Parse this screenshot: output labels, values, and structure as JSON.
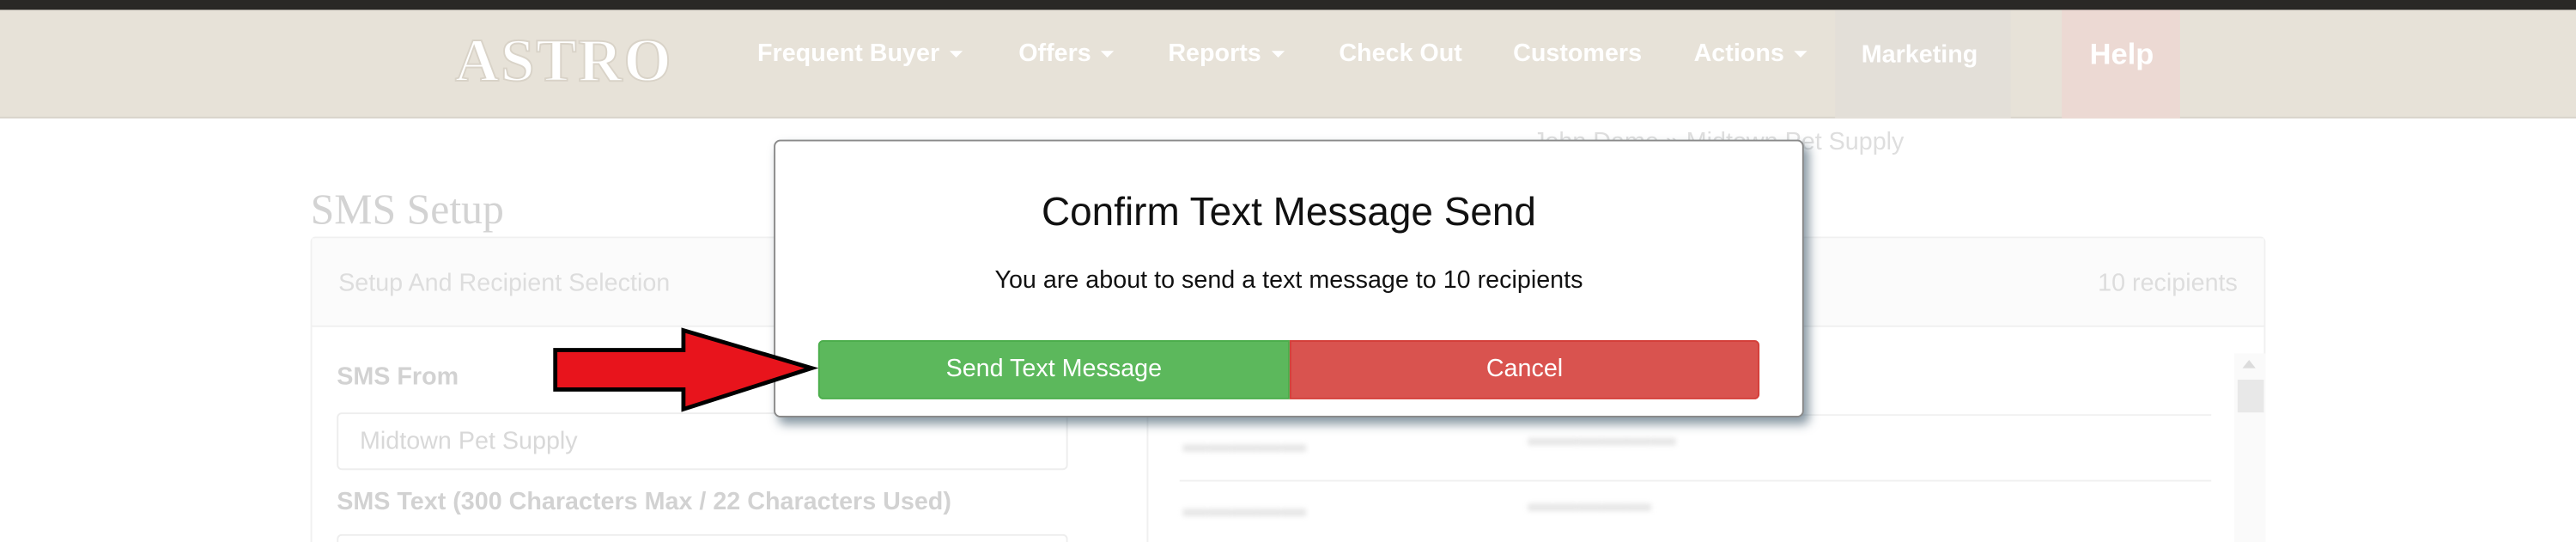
{
  "header": {
    "logo": "ASTRO",
    "nav": [
      {
        "label": "Frequent Buyer",
        "dropdown": true
      },
      {
        "label": "Offers",
        "dropdown": true
      },
      {
        "label": "Reports",
        "dropdown": true
      },
      {
        "label": "Check Out",
        "dropdown": false
      },
      {
        "label": "Customers",
        "dropdown": false
      },
      {
        "label": "Actions",
        "dropdown": true
      },
      {
        "label": "Marketing",
        "dropdown": false
      }
    ],
    "help_label": "Help"
  },
  "breadcrumb": "John Dame » Midtown Pet Supply",
  "page": {
    "title": "SMS Setup",
    "panel_title": "Setup And Recipient Selection",
    "recipients_count": "10 recipients",
    "sms_from_label": "SMS From",
    "sms_from_value": "Midtown Pet Supply",
    "sms_text_label": "SMS Text (300 Characters Max / 22 Characters Used)"
  },
  "modal": {
    "title": "Confirm Text Message Send",
    "body": "You are about to send a text message to 10 recipients",
    "send_label": "Send Text Message",
    "cancel_label": "Cancel"
  },
  "colors": {
    "send": "#5cb85c",
    "cancel": "#d9534f",
    "arrow": "#e8141c"
  }
}
